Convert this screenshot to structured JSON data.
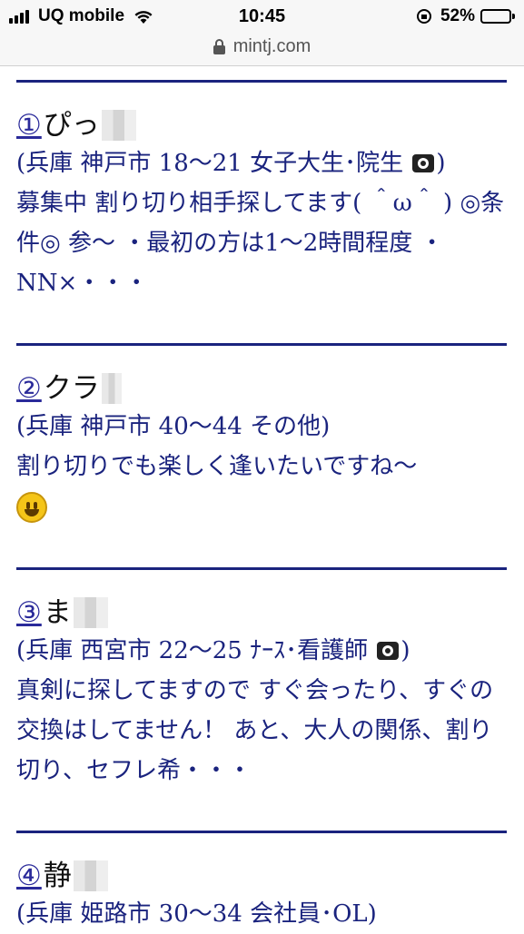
{
  "status_bar": {
    "carrier": "UQ mobile",
    "time": "10:45",
    "battery_percent": "52%",
    "battery_level": 0.52
  },
  "browser": {
    "url": "mintj.com"
  },
  "posts": [
    {
      "number": "①",
      "name": "ぴっ",
      "info": "(兵庫 神戸市 18〜21 女子大生･院生",
      "info_end": ")",
      "message": "募集中 割り切り相手探してます( ＾ω＾ ) ◎条件◎ 参〜 ・最初の方は1〜2時間程度 ・NN×・・・"
    },
    {
      "number": "②",
      "name": "クラ",
      "info": "(兵庫 神戸市 40〜44 その他)",
      "message": "割り切りでも楽しく逢いたいですね〜"
    },
    {
      "number": "③",
      "name": "ま",
      "info": "(兵庫 西宮市 22〜25 ﾅｰｽ･看護師",
      "info_end": ")",
      "message": "真剣に探してますので すぐ会ったり、すぐの交換はしてません！ あと、大人の関係、割り切り、セフレ希・・・"
    },
    {
      "number": "④",
      "name": "静",
      "info": "(兵庫 姫路市 30〜34 会社員･OL)"
    }
  ]
}
